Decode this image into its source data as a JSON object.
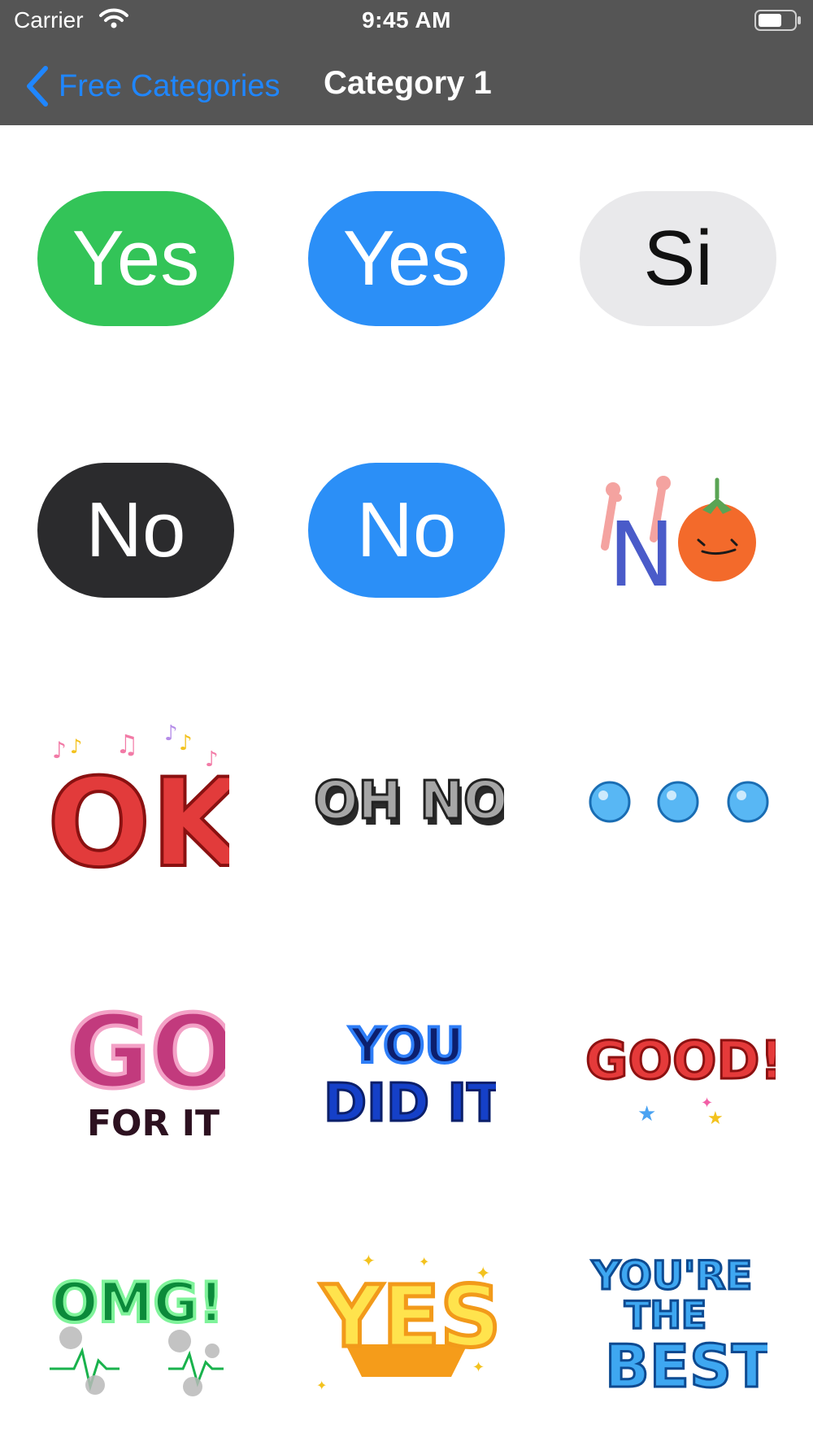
{
  "status_bar": {
    "carrier": "Carrier",
    "time": "9:45 AM"
  },
  "nav": {
    "back_label": "Free Categories",
    "title": "Category 1"
  },
  "colors": {
    "header_bg": "#555555",
    "accent": "#1f86ff",
    "bubble_green": "#33c458",
    "bubble_blue": "#2b8ff7",
    "bubble_gray": "#e9e9eb",
    "bubble_dark": "#2b2b2d"
  },
  "stickers": [
    {
      "text": "Yes",
      "style": "green-bubble"
    },
    {
      "text": "Yes",
      "style": "blue-bubble"
    },
    {
      "text": "Si",
      "style": "gray-bubble"
    },
    {
      "text": "No",
      "style": "dark-bubble"
    },
    {
      "text": "No",
      "style": "blue-bubble"
    },
    {
      "text": "N",
      "style": "tomato-doodle"
    },
    {
      "text": "OK",
      "style": "red-music"
    },
    {
      "text": "OH NO",
      "style": "stone-3d"
    },
    {
      "text": "",
      "style": "three-blue-dots"
    },
    {
      "line1": "GO",
      "line2": "FOR IT",
      "style": "pink-bold"
    },
    {
      "line1": "YOU",
      "line2": "DID IT",
      "style": "blue-bold"
    },
    {
      "text": "GOOD!",
      "style": "red-stars"
    },
    {
      "text": "OMG!",
      "style": "green-heartbeat"
    },
    {
      "text": "YES",
      "style": "yellow-sparkle"
    },
    {
      "line1": "YOU'RE",
      "line2": "THE",
      "line3": "BEST",
      "style": "blue-stacked"
    }
  ]
}
